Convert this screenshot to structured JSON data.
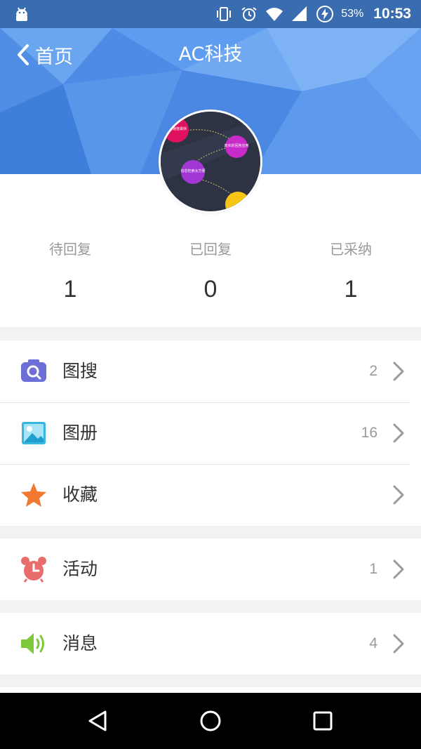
{
  "status_bar": {
    "battery_percent": "53%",
    "time": "10:53",
    "icons": [
      "android-debug-icon",
      "vibrate-icon",
      "alarm-icon",
      "wifi-icon",
      "signal-icon",
      "battery-charging-icon"
    ]
  },
  "header": {
    "back_label": "首页",
    "title": "AC科技",
    "colors": {
      "primary": "#4d8ee6",
      "status_bar": "#3a6db0"
    }
  },
  "avatar": {
    "bubble_texts": [
      "传播速度最快",
      "真实的回答应用",
      "信息检索太方便"
    ]
  },
  "stats": [
    {
      "label": "待回复",
      "value": "1"
    },
    {
      "label": "已回复",
      "value": "0"
    },
    {
      "label": "已采纳",
      "value": "1"
    }
  ],
  "menu": {
    "group1": [
      {
        "label": "图搜",
        "count": "2",
        "icon": "camera-search-icon",
        "color": "#6d6fd8"
      },
      {
        "label": "图册",
        "count": "16",
        "icon": "image-album-icon",
        "color": "#35b6e0"
      },
      {
        "label": "收藏",
        "count": "",
        "icon": "star-icon",
        "color": "#f27a30"
      }
    ],
    "group2": [
      {
        "label": "活动",
        "count": "1",
        "icon": "alarm-clock-icon",
        "color": "#ea6d6d"
      }
    ],
    "group3": [
      {
        "label": "消息",
        "count": "4",
        "icon": "speaker-icon",
        "color": "#7dc93a"
      }
    ]
  },
  "nav_bar": {
    "buttons": [
      "back-triangle-icon",
      "home-circle-icon",
      "recents-square-icon"
    ]
  }
}
